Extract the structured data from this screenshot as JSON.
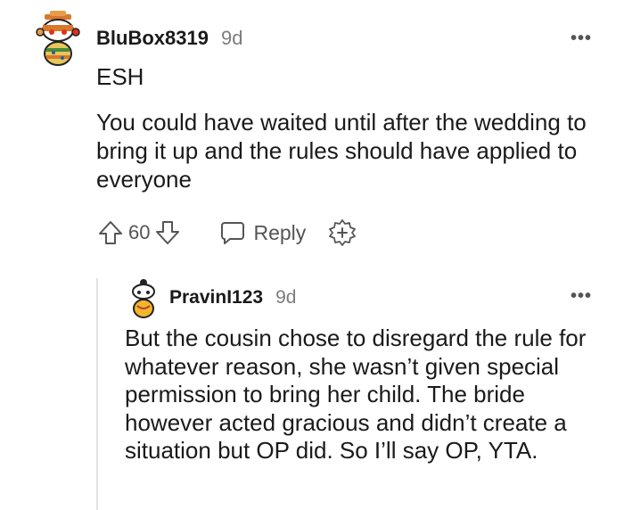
{
  "comment": {
    "author": "BluBox8319",
    "age": "9d",
    "verdict": "ESH",
    "body": "You could have waited until after the wedding to bring it up and the rules should have applied to everyone",
    "score": "60",
    "reply_label": "Reply",
    "more_label": "•••"
  },
  "reply": {
    "author": "PravinI123",
    "age": "9d",
    "body": "But the cousin chose to disregard the rule for whatever reason, she wasn’t given special permission to bring her child. The bride however acted gracious and didn’t create a situation but OP did. So I’ll say OP, YTA.",
    "more_label": "•••"
  },
  "icons": {
    "upvote": "arrow-up-icon",
    "downvote": "arrow-down-icon",
    "reply": "speech-bubble-icon",
    "award": "award-plus-icon",
    "more": "more-horizontal-icon"
  },
  "colors": {
    "text": "#1a1a1b",
    "meta": "#7c7c7c",
    "icon": "#555555",
    "thread_line": "#e2e2e2"
  }
}
